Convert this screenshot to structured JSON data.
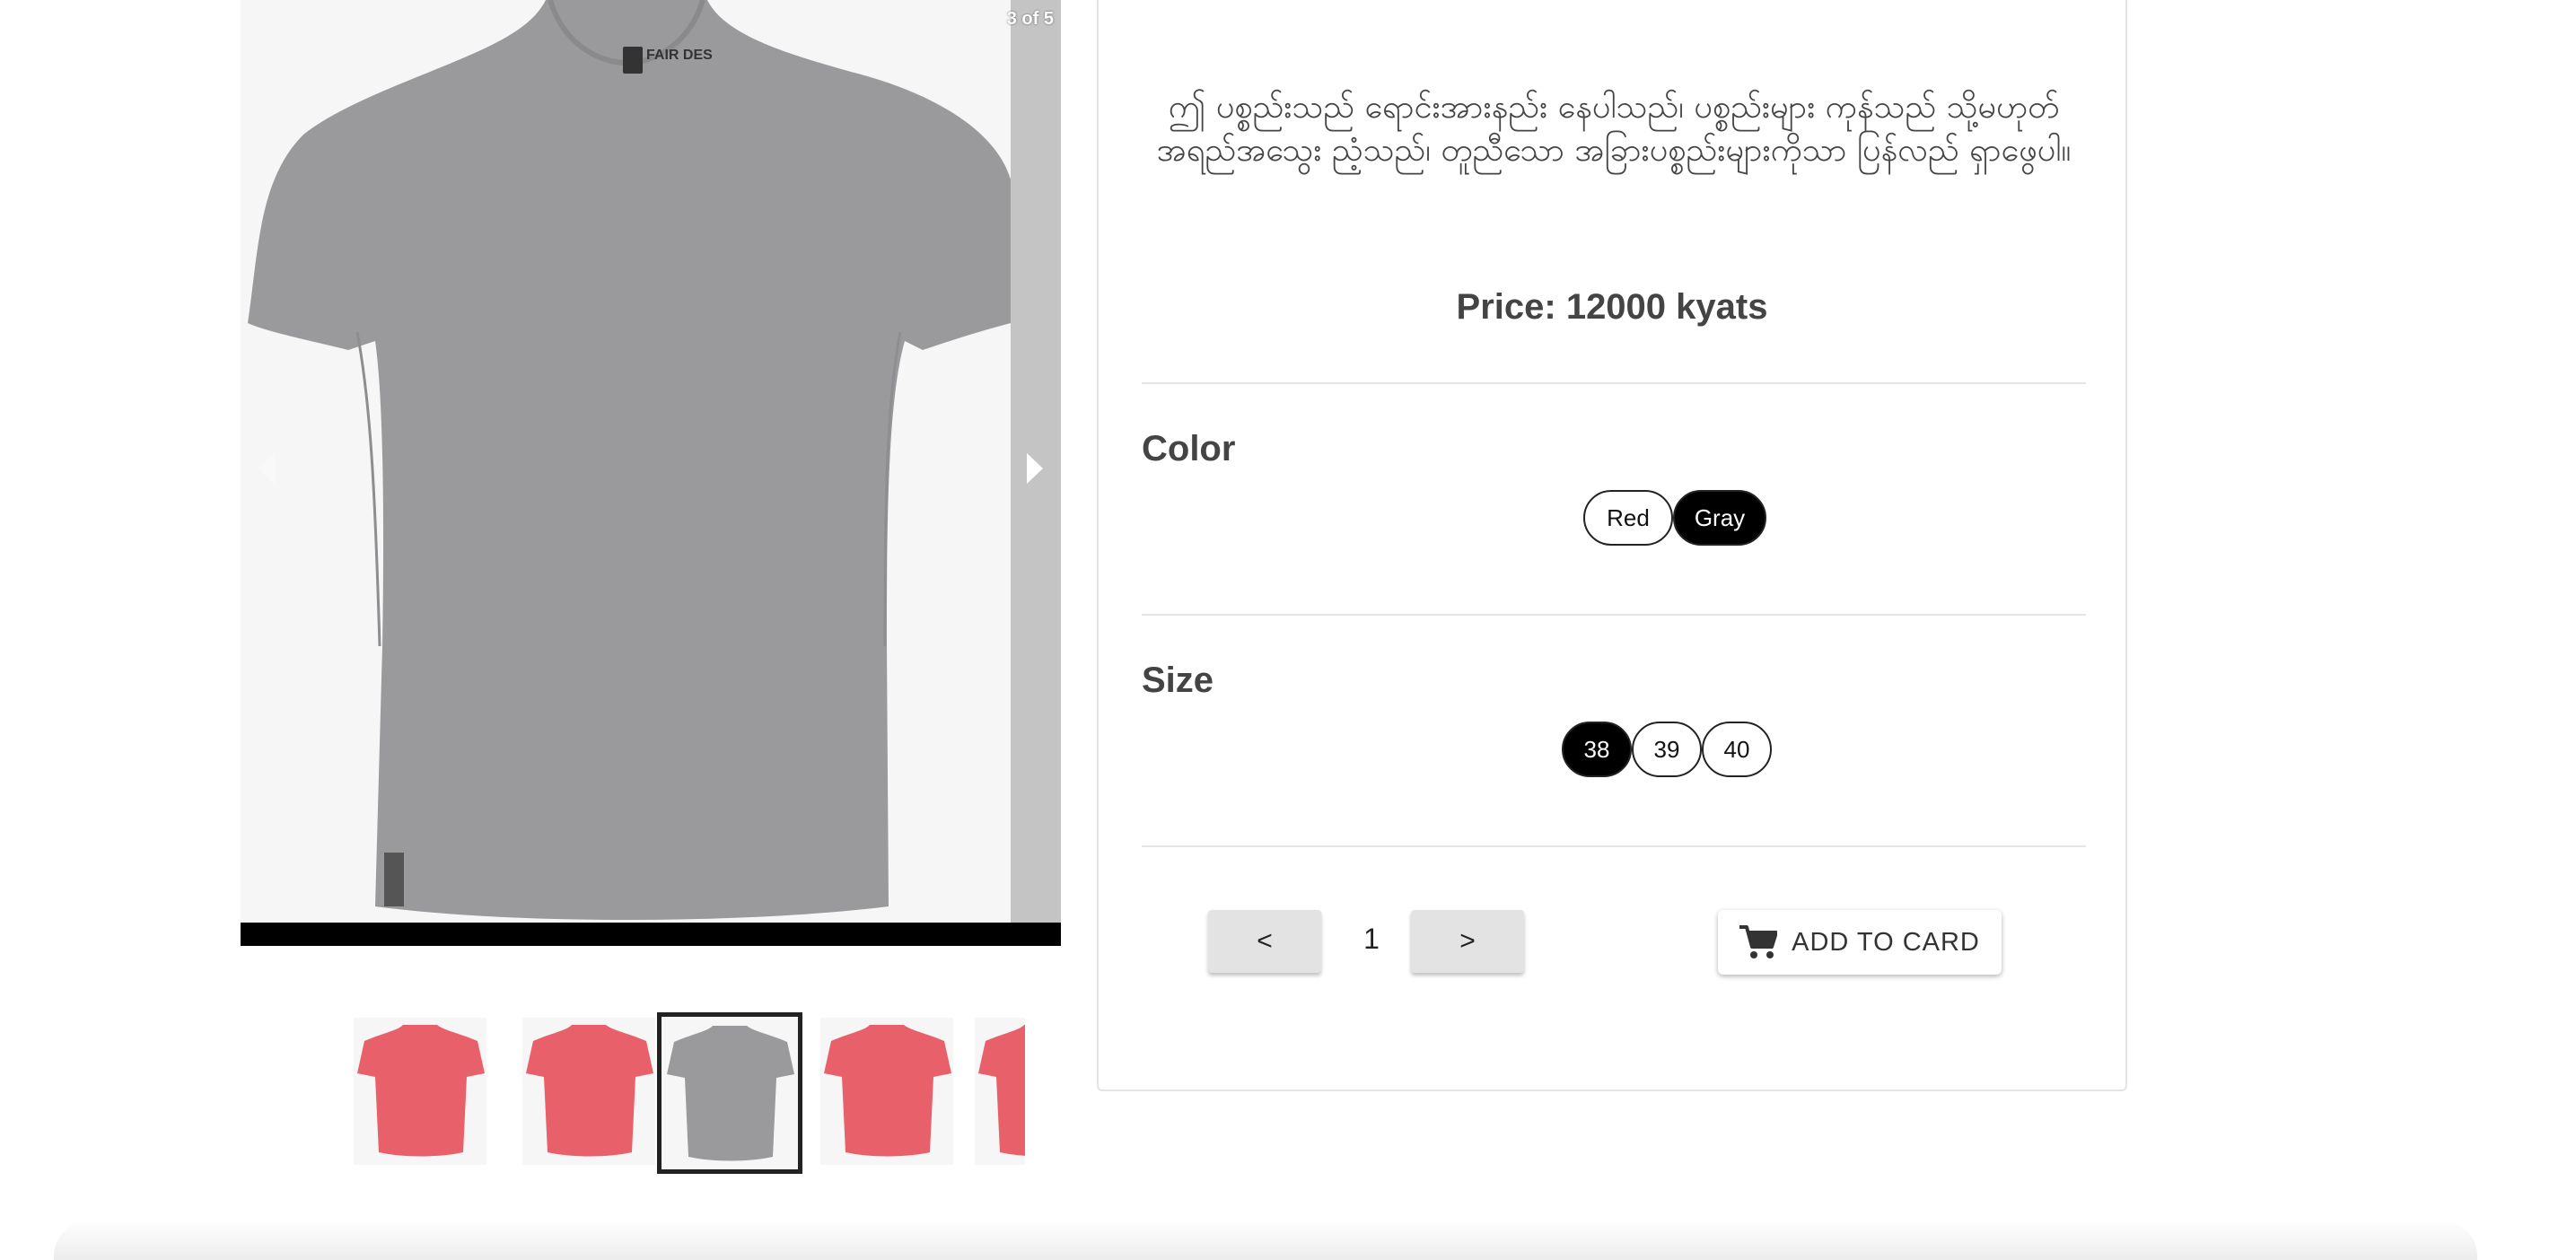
{
  "carousel": {
    "counter": "3 of 5",
    "current_color": "gray",
    "slide_shirt_color": "#9a9a9c",
    "logo_text": "FAIR DES"
  },
  "thumbnails": [
    {
      "color": "#e8616a",
      "selected": false
    },
    {
      "color": "#e8616a",
      "selected": false
    },
    {
      "color": "#9a9a9c",
      "selected": true
    },
    {
      "color": "#e8616a",
      "selected": false
    },
    {
      "color": "#e8616a",
      "selected": false
    }
  ],
  "product": {
    "description": "ဤ ပစ္စည်းသည် ရောင်းအားနည်း နေပါသည်၊ ပစ္စည်းများ ကုန်သည် သို့မဟုတ် အရည်အသွေး ညံ့သည်၊ တူညီသော အခြားပစ္စည်းများကိုသာ ပြန်လည် ရှာဖွေပါ။",
    "price": "Price: 12000 kyats"
  },
  "color_section": {
    "title": "Color",
    "options": [
      "Red",
      "Gray"
    ],
    "selected": "Gray"
  },
  "size_section": {
    "title": "Size",
    "options": [
      "38",
      "39",
      "40"
    ],
    "selected": "38"
  },
  "quantity": {
    "decrement_label": "<",
    "value": "1",
    "increment_label": ">"
  },
  "cart": {
    "button_label": "ADD TO CARD"
  }
}
